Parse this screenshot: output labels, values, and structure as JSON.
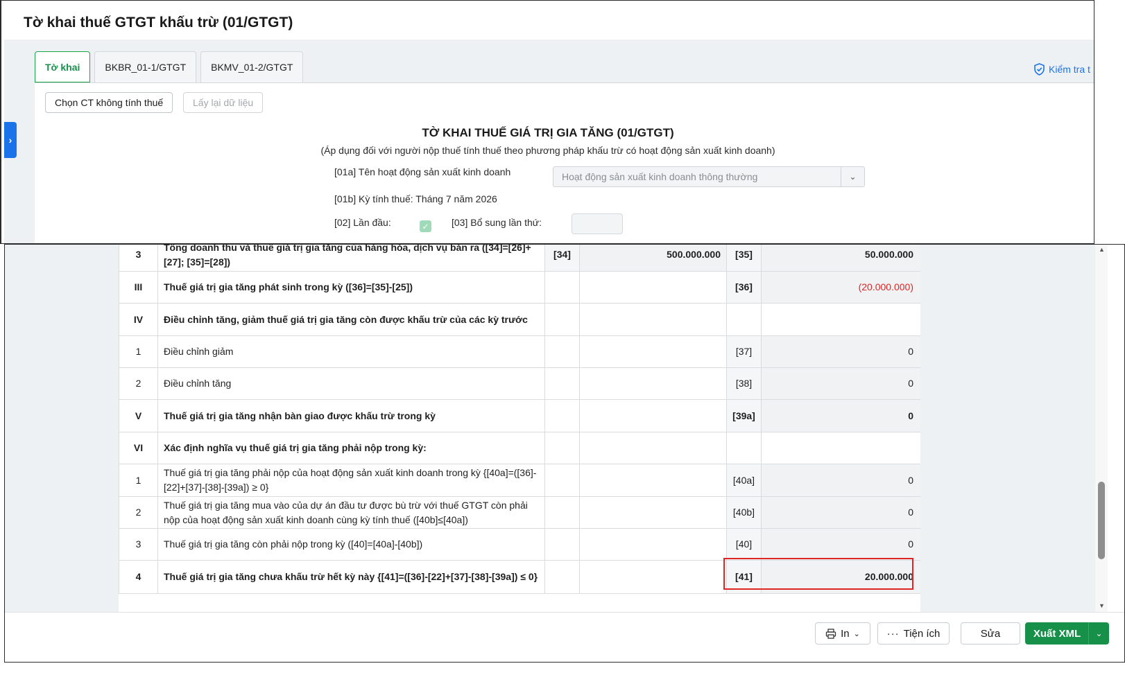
{
  "window_title": "Tờ khai thuế GTGT khấu trừ (01/GTGT)",
  "tabs": [
    {
      "label": "Tờ khai",
      "active": true
    },
    {
      "label": "BKBR_01-1/GTGT",
      "active": false
    },
    {
      "label": "BKMV_01-2/GTGT",
      "active": false
    }
  ],
  "check_link": "Kiểm tra t",
  "toolbar": {
    "choose_button": "Chọn CT không tính thuế",
    "reload_button": "Lấy lại dữ liệu"
  },
  "form": {
    "title": "TỜ KHAI THUẾ GIÁ TRỊ GIA TĂNG (01/GTGT)",
    "subtitle": "(Áp dụng đối với người nộp thuế tính thuế theo phương pháp khấu trừ có hoạt động sản xuất kinh doanh)",
    "activity_label": "[01a] Tên hoạt động sản xuất kinh doanh",
    "activity_value": "Hoạt động sản xuất kinh doanh thông thường",
    "period_label": "[01b] Kỳ tính thuế: Tháng 7 năm 2026",
    "first_time_label": "[02] Lần đầu:",
    "first_time_checked": true,
    "supplement_label": "[03] Bổ sung lần thứ:"
  },
  "table": {
    "rows": [
      {
        "stt": "3",
        "desc": "Tổng doanh thu và thuế giá trị gia tăng của hàng hóa, dịch vụ bán ra ([34]=[26]+[27]; [35]=[28])",
        "code1": "[34]",
        "val1": "500.000.000",
        "code2": "[35]",
        "val2": "50.000.000",
        "bold": true
      },
      {
        "stt": "III",
        "desc": "Thuế giá trị gia tăng phát sinh trong kỳ ([36]=[35]-[25])",
        "code1": "",
        "val1": "",
        "code2": "[36]",
        "val2": "(20.000.000)",
        "bold": true,
        "negative": true
      },
      {
        "stt": "IV",
        "desc": "Điều chỉnh tăng, giảm thuế giá trị gia tăng còn được khấu trừ của các kỳ trước",
        "code1": "",
        "val1": "",
        "code2": "",
        "val2": "",
        "bold": true
      },
      {
        "stt": "1",
        "desc": "Điều chỉnh giảm",
        "code1": "",
        "val1": "",
        "code2": "[37]",
        "val2": "0",
        "bold": false
      },
      {
        "stt": "2",
        "desc": "Điều chỉnh tăng",
        "code1": "",
        "val1": "",
        "code2": "[38]",
        "val2": "0",
        "bold": false
      },
      {
        "stt": "V",
        "desc": "Thuế giá trị gia tăng nhận bàn giao được khấu trừ trong kỳ",
        "code1": "",
        "val1": "",
        "code2": "[39a]",
        "val2": "0",
        "bold": true
      },
      {
        "stt": "VI",
        "desc": "Xác định nghĩa vụ thuế giá trị gia tăng phải nộp trong kỳ:",
        "code1": "",
        "val1": "",
        "code2": "",
        "val2": "",
        "bold": true
      },
      {
        "stt": "1",
        "desc": "Thuế giá trị gia tăng phải nộp của hoạt động sản xuất kinh doanh trong kỳ {[40a]=([36]-[22]+[37]-[38]-[39a]) ≥ 0}",
        "code1": "",
        "val1": "",
        "code2": "[40a]",
        "val2": "0",
        "bold": false
      },
      {
        "stt": "2",
        "desc": "Thuế giá trị gia tăng mua vào của dự án đầu tư được bù trừ với thuế GTGT còn phải nộp của hoạt động sản xuất kinh doanh cùng kỳ tính thuế ([40b]≤[40a])",
        "code1": "",
        "val1": "",
        "code2": "[40b]",
        "val2": "0",
        "bold": false
      },
      {
        "stt": "3",
        "desc": "Thuế giá trị gia tăng còn phải nộp trong kỳ ([40]=[40a]-[40b])",
        "code1": "",
        "val1": "",
        "code2": "[40]",
        "val2": "0",
        "bold": false
      },
      {
        "stt": "4",
        "desc": "Thuế giá trị gia tăng chưa khấu trừ hết kỳ này {[41]=([36]-[22]+[37]-[38]-[39a]) ≤ 0}",
        "code1": "",
        "val1": "",
        "code2": "[41]",
        "val2": "20.000.000",
        "bold": true,
        "highlighted": true
      }
    ]
  },
  "footer": {
    "print_label": "In",
    "utilities_label": "Tiện ích",
    "edit_label": "Sửa",
    "export_label": "Xuất XML"
  },
  "colors": {
    "accent_green": "#17904a",
    "link_blue": "#1a73e8",
    "negative_red": "#e02424"
  }
}
